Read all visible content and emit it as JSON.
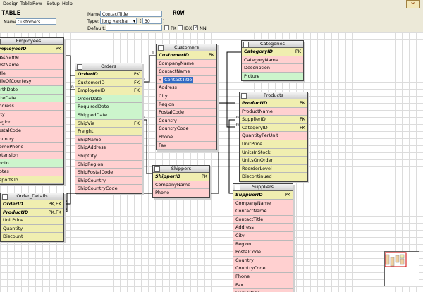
{
  "menu": [
    "Design",
    "Table",
    "Row",
    "Setup",
    "Help"
  ],
  "logo_glyph": "✂",
  "props": {
    "table_heading": "TABLE",
    "row_heading": "ROW",
    "name_label": "Name:",
    "table_name": "Customers",
    "row_name": "ContactTitle",
    "type_label": "Type:",
    "type_value": "long varchar",
    "size_value": "30",
    "default_label": "Default:",
    "pk_label": "PK",
    "idx_label": "IDX",
    "nn_label": "NN",
    "nn_checked": "✓"
  },
  "tables": {
    "employees": {
      "title": "Employees",
      "rows": [
        {
          "name": "EmployeeID",
          "key": "PK",
          "cls": "pk"
        },
        {
          "name": "LastName",
          "cls": "p"
        },
        {
          "name": "FirstName",
          "cls": "p"
        },
        {
          "name": "Title",
          "cls": "p"
        },
        {
          "name": "TitleOfCourtesy",
          "cls": "p"
        },
        {
          "name": "BirthDate",
          "cls": "g"
        },
        {
          "name": "HireDate",
          "cls": "g"
        },
        {
          "name": "Address",
          "cls": "p"
        },
        {
          "name": "City",
          "cls": "p"
        },
        {
          "name": "Region",
          "cls": "p"
        },
        {
          "name": "PostalCode",
          "cls": "p"
        },
        {
          "name": "Country",
          "cls": "p"
        },
        {
          "name": "HomePhone",
          "cls": "p"
        },
        {
          "name": "Extension",
          "cls": "p"
        },
        {
          "name": "Photo",
          "cls": "g"
        },
        {
          "name": "Notes",
          "cls": "p"
        },
        {
          "name": "ReportsTo",
          "cls": "y"
        }
      ]
    },
    "orders": {
      "title": "Orders",
      "rows": [
        {
          "name": "OrderID",
          "key": "PK",
          "cls": "pk"
        },
        {
          "name": "CustomerID",
          "key": "FK",
          "cls": "fk"
        },
        {
          "name": "EmployeeID",
          "key": "FK",
          "cls": "fk"
        },
        {
          "name": "OrderDate",
          "cls": "g"
        },
        {
          "name": "RequiredDate",
          "cls": "g"
        },
        {
          "name": "ShippedDate",
          "cls": "g"
        },
        {
          "name": "ShipVia",
          "key": "FK",
          "cls": "fk"
        },
        {
          "name": "Freight",
          "cls": "y"
        },
        {
          "name": "ShipName",
          "cls": "p"
        },
        {
          "name": "ShipAddress",
          "cls": "p"
        },
        {
          "name": "ShipCity",
          "cls": "p"
        },
        {
          "name": "ShipRegion",
          "cls": "p"
        },
        {
          "name": "ShipPostalCode",
          "cls": "p"
        },
        {
          "name": "ShipCountry",
          "cls": "p"
        },
        {
          "name": "ShipCountryCode",
          "cls": "p"
        }
      ]
    },
    "customers": {
      "title": "Customers",
      "rows": [
        {
          "name": "CustomerID",
          "key": "PK",
          "cls": "pk"
        },
        {
          "name": "CompanyName",
          "cls": "p"
        },
        {
          "name": "ContactName",
          "cls": "p"
        },
        {
          "name": "ContactTitle",
          "cls": "sel",
          "selected": "»"
        },
        {
          "name": "Address",
          "cls": "p"
        },
        {
          "name": "City",
          "cls": "p"
        },
        {
          "name": "Region",
          "cls": "p"
        },
        {
          "name": "PostalCode",
          "cls": "p"
        },
        {
          "name": "Country",
          "cls": "p"
        },
        {
          "name": "CountryCode",
          "cls": "p"
        },
        {
          "name": "Phone",
          "cls": "p"
        },
        {
          "name": "Fax",
          "cls": "p"
        }
      ]
    },
    "categories": {
      "title": "Categories",
      "rows": [
        {
          "name": "CategoryID",
          "key": "PK",
          "cls": "pk"
        },
        {
          "name": "CategoryName",
          "cls": "p"
        },
        {
          "name": "Description",
          "cls": "p"
        },
        {
          "name": "Picture",
          "cls": "g"
        }
      ]
    },
    "products": {
      "title": "Products",
      "rows": [
        {
          "name": "ProductID",
          "key": "PK",
          "cls": "pk"
        },
        {
          "name": "ProductName",
          "cls": "p"
        },
        {
          "name": "SupplierID",
          "key": "FK",
          "cls": "fk"
        },
        {
          "name": "CategoryID",
          "key": "FK",
          "cls": "fk"
        },
        {
          "name": "QuantityPerUnit",
          "cls": "p"
        },
        {
          "name": "UnitPrice",
          "cls": "y"
        },
        {
          "name": "UnitsInStock",
          "cls": "y"
        },
        {
          "name": "UnitsOnOrder",
          "cls": "y"
        },
        {
          "name": "ReorderLevel",
          "cls": "y"
        },
        {
          "name": "Discontinued",
          "cls": "y"
        }
      ]
    },
    "shippers": {
      "title": "Shippers",
      "rows": [
        {
          "name": "ShipperID",
          "key": "PK",
          "cls": "pk"
        },
        {
          "name": "CompanyName",
          "cls": "p"
        },
        {
          "name": "Phone",
          "cls": "p"
        }
      ]
    },
    "order_details": {
      "title": "Order_Details",
      "rows": [
        {
          "name": "OrderID",
          "key": "PK,FK",
          "cls": "pk"
        },
        {
          "name": "ProductID",
          "key": "PK,FK",
          "cls": "pk"
        },
        {
          "name": "UnitPrice",
          "cls": "y"
        },
        {
          "name": "Quantity",
          "cls": "y"
        },
        {
          "name": "Discount",
          "cls": "y"
        }
      ]
    },
    "suppliers": {
      "title": "Suppliers",
      "rows": [
        {
          "name": "SupplierID",
          "key": "PK",
          "cls": "pk"
        },
        {
          "name": "CompanyName",
          "cls": "p"
        },
        {
          "name": "ContactName",
          "cls": "p"
        },
        {
          "name": "ContactTitle",
          "cls": "p"
        },
        {
          "name": "Address",
          "cls": "p"
        },
        {
          "name": "City",
          "cls": "p"
        },
        {
          "name": "Region",
          "cls": "p"
        },
        {
          "name": "PostalCode",
          "cls": "p"
        },
        {
          "name": "Country",
          "cls": "p"
        },
        {
          "name": "CountryCode",
          "cls": "p"
        },
        {
          "name": "Phone",
          "cls": "p"
        },
        {
          "name": "Fax",
          "cls": "p"
        },
        {
          "name": "HomePage",
          "cls": "p"
        }
      ]
    }
  },
  "relation_labels": {
    "one": "1",
    "many": "n"
  },
  "colors": {
    "pk": "#f0eeb0",
    "text_col": "#ffd0d0",
    "date_col": "#ccf5cc",
    "selection": "#316ac5",
    "minimap_view": "#d00000"
  }
}
